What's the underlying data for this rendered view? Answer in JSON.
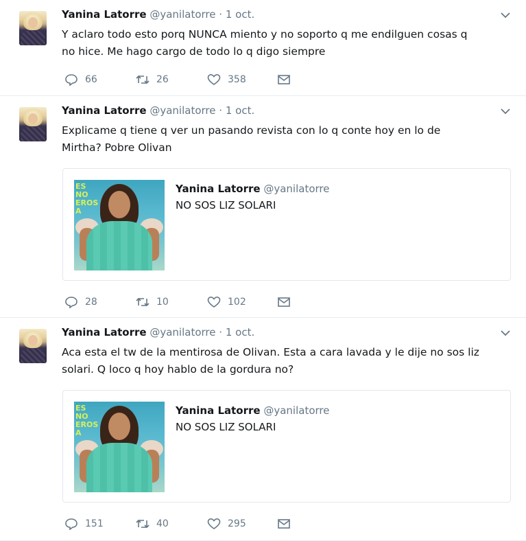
{
  "tweets": [
    {
      "author": "Yanina Latorre",
      "handle": "@yanilatorre",
      "separator": "·",
      "date": "1 oct.",
      "text_line1": "Y aclaro todo esto porq NUNCA miento y no soporto q me endilguen cosas q",
      "text_line2": "no hice. Me hago cargo de todo lo q digo siempre",
      "replies": "66",
      "retweets": "26",
      "likes": "358"
    },
    {
      "author": "Yanina Latorre",
      "handle": "@yanilatorre",
      "separator": "·",
      "date": "1 oct.",
      "text_line1": "Explicame q tiene q ver un pasando revista con lo q conte hoy en lo de",
      "text_line2": "Mirtha? Pobre Olivan",
      "quote": {
        "thumb_text": "ES NO EROS A",
        "author": "Yanina Latorre",
        "handle": "@yanilatorre",
        "text": "NO SOS LIZ SOLARI"
      },
      "replies": "28",
      "retweets": "10",
      "likes": "102"
    },
    {
      "author": "Yanina Latorre",
      "handle": "@yanilatorre",
      "separator": "·",
      "date": "1 oct.",
      "text_line1": "Aca esta el tw de la mentirosa de Olivan. Esta a cara lavada y le dije no sos liz",
      "text_line2": "solari. Q loco q hoy hablo de la gordura no?",
      "quote": {
        "thumb_text": "ES NO EROS A",
        "author": "Yanina Latorre",
        "handle": "@yanilatorre",
        "text": "NO SOS LIZ SOLARI"
      },
      "replies": "151",
      "retweets": "40",
      "likes": "295"
    }
  ],
  "icons": {
    "reply": "reply-icon",
    "retweet": "retweet-icon",
    "like": "heart-icon",
    "message": "envelope-icon",
    "menu": "chevron-down-icon"
  },
  "colors": {
    "text": "#14171a",
    "muted": "#657786",
    "border": "#e6ecf0"
  }
}
